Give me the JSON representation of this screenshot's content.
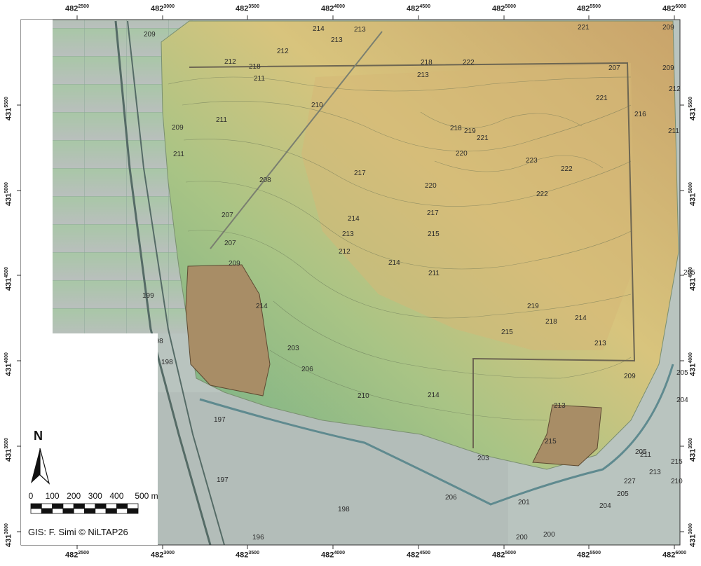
{
  "map": {
    "easting_prefix": "482",
    "easting_ticks": [
      "2500",
      "3000",
      "3500",
      "4000",
      "4500",
      "5000",
      "5500",
      "6000"
    ],
    "northing_prefix": "431",
    "northing_ticks": [
      "5500",
      "5000",
      "4500",
      "4000",
      "3500",
      "3000"
    ],
    "north_label": "N",
    "scale": {
      "labels": [
        "0",
        "100",
        "200",
        "300",
        "400",
        "500 m"
      ]
    },
    "credit": "GIS: F. Simi © NiLTAP26",
    "contour_labels": [
      "214",
      "213",
      "213",
      "221",
      "209",
      "209",
      "212",
      "218",
      "218",
      "222",
      "207",
      "212",
      "211",
      "213",
      "221",
      "212",
      "210",
      "216",
      "211",
      "211",
      "218",
      "219",
      "221",
      "220",
      "223",
      "222",
      "209",
      "211",
      "209",
      "208",
      "217",
      "220",
      "222",
      "207",
      "214",
      "217",
      "215",
      "213",
      "207",
      "212",
      "214",
      "209",
      "211",
      "214",
      "219",
      "218",
      "214",
      "215",
      "213",
      "205",
      "203",
      "206",
      "210",
      "214",
      "213",
      "209",
      "215",
      "205",
      "203",
      "213",
      "205",
      "197",
      "197",
      "199",
      "201",
      "204",
      "200",
      "200",
      "196",
      "198",
      "198",
      "198",
      "198",
      "206",
      "204",
      "205",
      "211",
      "215",
      "210",
      "227"
    ],
    "colors": {
      "low": "#7fbf8a",
      "mid": "#d4c37a",
      "high": "#c99a62",
      "plain": "#aeb9b6"
    }
  }
}
